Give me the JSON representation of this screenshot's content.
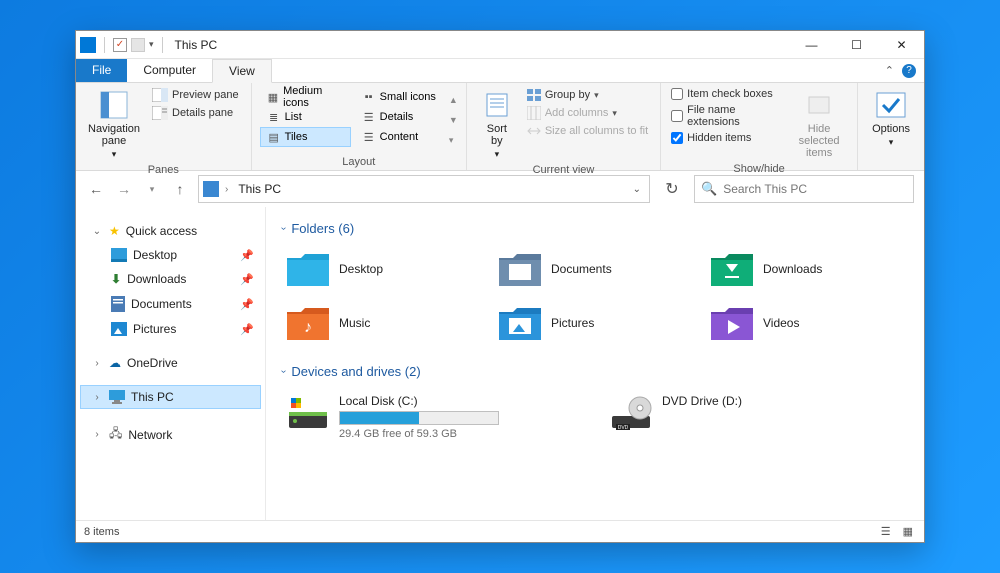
{
  "title": "This PC",
  "tabs": {
    "file": "File",
    "computer": "Computer",
    "view": "View"
  },
  "ribbon": {
    "panes": {
      "navigation": "Navigation\npane",
      "preview": "Preview pane",
      "details": "Details pane",
      "label": "Panes"
    },
    "layout": {
      "medium": "Medium icons",
      "small": "Small icons",
      "list": "List",
      "details": "Details",
      "tiles": "Tiles",
      "content": "Content",
      "label": "Layout"
    },
    "current": {
      "sort": "Sort\nby",
      "group": "Group by",
      "addcols": "Add columns",
      "sizecols": "Size all columns to fit",
      "label": "Current view"
    },
    "showhide": {
      "checkboxes": "Item check boxes",
      "extensions": "File name extensions",
      "hidden": "Hidden items",
      "hideselected": "Hide selected\nitems",
      "label": "Show/hide"
    },
    "options": "Options"
  },
  "address": {
    "crumb": "This PC"
  },
  "search": {
    "placeholder": "Search This PC"
  },
  "sidebar": {
    "quick": "Quick access",
    "desktop": "Desktop",
    "downloads": "Downloads",
    "documents": "Documents",
    "pictures": "Pictures",
    "onedrive": "OneDrive",
    "thispc": "This PC",
    "network": "Network"
  },
  "sections": {
    "folders_label": "Folders (6)",
    "drives_label": "Devices and drives (2)"
  },
  "folders": {
    "desktop": "Desktop",
    "documents": "Documents",
    "downloads": "Downloads",
    "music": "Music",
    "pictures": "Pictures",
    "videos": "Videos"
  },
  "drives": {
    "c": {
      "name": "Local Disk (C:)",
      "free": "29.4 GB free of 59.3 GB",
      "used_pct": 50
    },
    "d": {
      "name": "DVD Drive (D:)"
    }
  },
  "status": {
    "items": "8 items"
  }
}
